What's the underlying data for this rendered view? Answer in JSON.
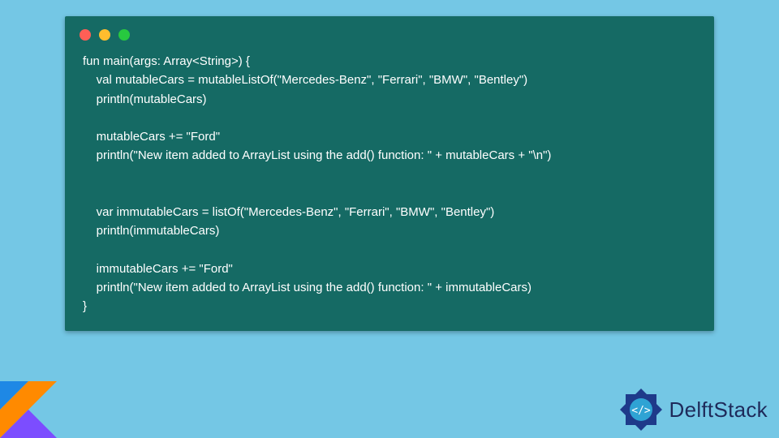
{
  "code": {
    "lines": [
      "fun main(args: Array<String>) {",
      "    val mutableCars = mutableListOf(\"Mercedes-Benz\", \"Ferrari\", \"BMW\", \"Bentley\")",
      "    println(mutableCars)",
      "",
      "    mutableCars += \"Ford\"",
      "    println(\"New item added to ArrayList using the add() function: \" + mutableCars + \"\\n\")",
      "",
      "",
      "    var immutableCars = listOf(\"Mercedes-Benz\", \"Ferrari\", \"BMW\", \"Bentley\")",
      "    println(immutableCars)",
      "",
      "    immutableCars += \"Ford\"",
      "    println(\"New item added to ArrayList using the add() function: \" + immutableCars)",
      "}"
    ]
  },
  "brand": {
    "name": "DelftStack"
  },
  "colors": {
    "page_bg": "#74c7e5",
    "code_bg": "#156a64",
    "code_fg": "#ffffff",
    "brand_text": "#1e2a5a",
    "dot_red": "#ff5f56",
    "dot_yellow": "#ffbd2e",
    "dot_green": "#27c93f"
  }
}
